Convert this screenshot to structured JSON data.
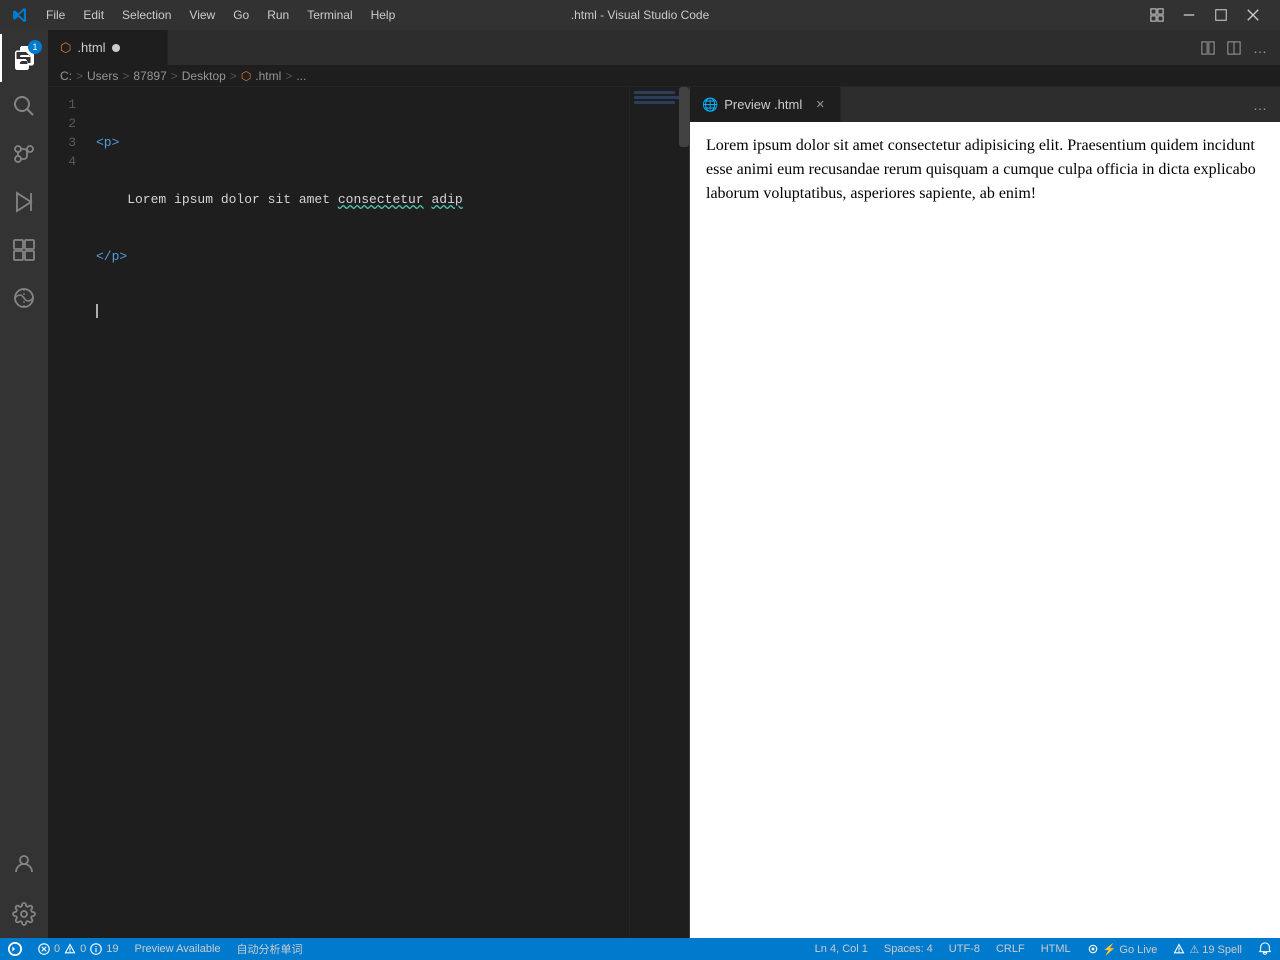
{
  "titleBar": {
    "title": ".html - Visual Studio Code",
    "menus": [
      "File",
      "Edit",
      "Selection",
      "View",
      "Go",
      "Run",
      "Terminal",
      "Help"
    ],
    "windowControls": {
      "tile": "⊞",
      "minimize": "—",
      "maximize": "☐",
      "close": "✕"
    }
  },
  "activityBar": {
    "items": [
      {
        "icon": "explorer-icon",
        "label": "Explorer",
        "active": true,
        "badge": "1"
      },
      {
        "icon": "search-icon",
        "label": "Search"
      },
      {
        "icon": "source-control-icon",
        "label": "Source Control"
      },
      {
        "icon": "run-icon",
        "label": "Run and Debug"
      },
      {
        "icon": "extensions-icon",
        "label": "Extensions"
      },
      {
        "icon": "remote-icon",
        "label": "Remote Explorer"
      }
    ],
    "bottomItems": [
      {
        "icon": "account-icon",
        "label": "Account"
      },
      {
        "icon": "settings-icon",
        "label": "Settings"
      }
    ]
  },
  "editor": {
    "tab": {
      "icon": "html-icon",
      "filename": ".html",
      "dirty": true
    },
    "tabActions": {
      "splitEditor": "⊞",
      "editorLayout": "⊟",
      "more": "…"
    },
    "breadcrumb": {
      "drive": "C:",
      "sep1": ">",
      "users": "Users",
      "sep2": ">",
      "user": "87897",
      "sep3": ">",
      "desktop": "Desktop",
      "sep4": ">",
      "htmlIcon": "html-icon",
      "filename": ".html",
      "sep5": ">",
      "more": "..."
    },
    "lines": [
      {
        "num": "1",
        "content": "<p>"
      },
      {
        "num": "2",
        "content": "    Lorem ipsum dolor sit amet consectetur adip"
      },
      {
        "num": "3",
        "content": "</p>"
      },
      {
        "num": "4",
        "content": ""
      }
    ],
    "loremText": "Lorem ipsum dolor sit amet consectetur adip"
  },
  "preview": {
    "tab": {
      "icon": "preview-icon",
      "title": "Preview .html",
      "closeBtn": "✕"
    },
    "moreBtn": "…",
    "content": "Lorem ipsum dolor sit amet consectetur adipisicing elit. Praesentium quidem incidunt esse animi eum recusandae rerum quisquam a cumque culpa officia in dicta explicabo laborum voluptatibus, asperiores sapiente, ab enim!"
  },
  "statusBar": {
    "leftItems": [
      {
        "icon": "remote-status-icon",
        "text": "⚡"
      },
      {
        "icon": "error-icon",
        "text": "⊗ 0"
      },
      {
        "icon": "warning-icon",
        "text": "⚠ 0"
      },
      {
        "icon": "info-icon",
        "text": "ℹ 19"
      },
      {
        "text": "Preview Available"
      },
      {
        "text": "自动分析单词"
      }
    ],
    "rightItems": [
      {
        "text": "Ln 4, Col 1"
      },
      {
        "text": "Spaces: 4"
      },
      {
        "text": "UTF-8"
      },
      {
        "text": "CRLF"
      },
      {
        "text": "HTML"
      },
      {
        "icon": "golive-icon",
        "text": "⚡ Go Live"
      },
      {
        "icon": "warning-icon",
        "text": "⚠ 19 Spell"
      },
      {
        "icon": "notification-icon",
        "text": "🔔"
      }
    ]
  }
}
